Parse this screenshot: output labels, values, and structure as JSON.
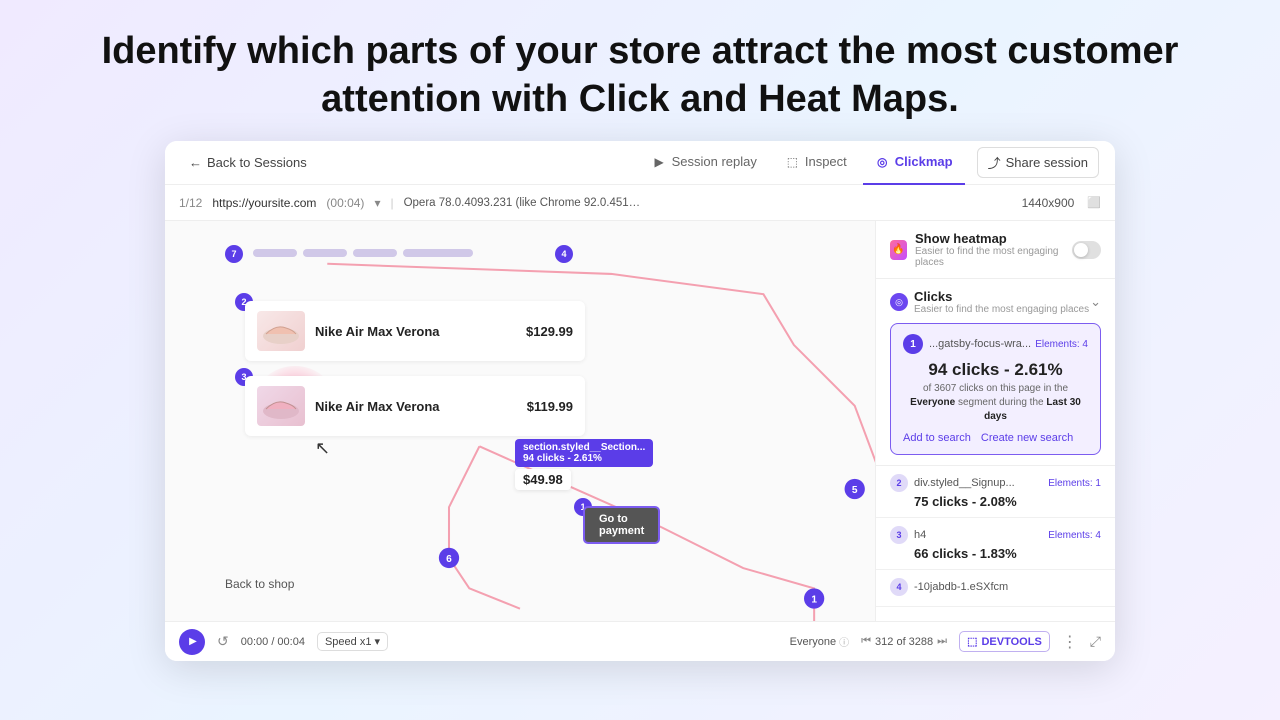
{
  "hero": {
    "title": "Identify which parts of your store attract the most customer attention with Click and Heat Maps."
  },
  "topbar": {
    "back_label": "Back to Sessions",
    "tabs": [
      {
        "id": "session-replay",
        "label": "Session replay",
        "active": false,
        "icon": "▶"
      },
      {
        "id": "inspect",
        "label": "Inspect",
        "active": false,
        "icon": "⬚"
      },
      {
        "id": "clickmap",
        "label": "Clickmap",
        "active": true,
        "icon": "◎"
      }
    ],
    "share_label": "Share session"
  },
  "urlbar": {
    "counter": "1/12",
    "url": "https://yoursite.com",
    "time": "(00:04)",
    "browser": "Opera 78.0.4093.231 (like Chrome 92.0.4515.159) ...",
    "resolution": "1440x900"
  },
  "sidebar": {
    "heatmap": {
      "label": "Show heatmap",
      "sub": "Easier to find the most engaging places"
    },
    "clicks": {
      "title": "Clicks",
      "sub": "Easier to find the most engaging places"
    },
    "elements": [
      {
        "num": 1,
        "name": "...gatsby-focus-wra...",
        "count_label": "Elements: 4",
        "stat": "94 clicks - 2.61%",
        "of_total": "of 3607 clicks on this page in the",
        "segment": "Everyone",
        "period": "Last 30 days",
        "actions": [
          "Add to search",
          "Create new search"
        ]
      },
      {
        "num": 2,
        "name": "div.styled__Signup...",
        "count_label": "Elements: 1",
        "stat": "75 clicks - 2.08%"
      },
      {
        "num": 3,
        "name": "h4",
        "count_label": "Elements: 4",
        "stat": "66 clicks - 1.83%"
      },
      {
        "num": 4,
        "name": "-10jabdb-1.eSXfcm",
        "count_label": ""
      }
    ]
  },
  "products": [
    {
      "name": "Nike Air Max Verona",
      "price": "$129.99",
      "badge": "2"
    },
    {
      "name": "Nike Air Max Verona",
      "price": "$119.99",
      "badge": "3"
    }
  ],
  "tooltip": {
    "line1": "section.styled__Section...",
    "line2": "94 clicks - 2.61%"
  },
  "map": {
    "payment_btn": "Go to payment",
    "back_shop": "Back to shop",
    "price1": "$49.98",
    "badge_main": "1"
  },
  "player": {
    "time": "00:00 / 00:04",
    "speed": "Speed x1",
    "segment": "Everyone",
    "session_count": "312 of 3288",
    "devtools": "DEVTOOLS"
  }
}
